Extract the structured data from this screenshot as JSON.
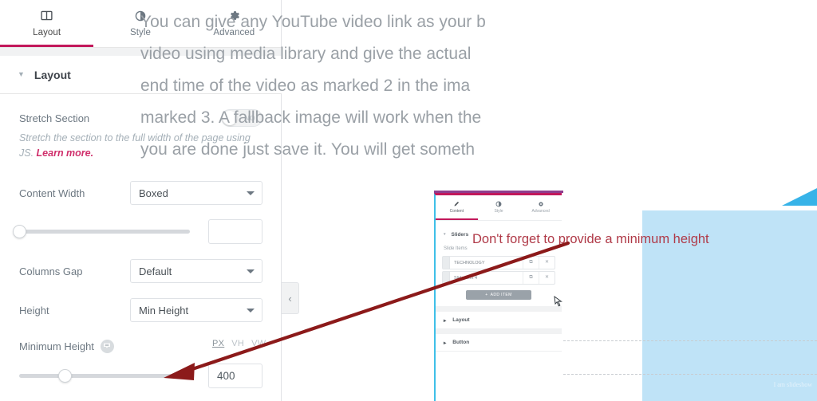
{
  "panel": {
    "tabs": [
      {
        "label": "Layout",
        "icon": "layout-columns-icon",
        "active": true
      },
      {
        "label": "Style",
        "icon": "contrast-circle-icon",
        "active": false
      },
      {
        "label": "Advanced",
        "icon": "gear-icon",
        "active": false
      }
    ],
    "section": {
      "title": "Layout",
      "caret": "▼"
    },
    "stretch": {
      "label": "Stretch Section",
      "toggle_value": "NO",
      "description_plain": "Stretch the section to the full width of the page using JS. ",
      "description_link": "Learn more."
    },
    "content_width": {
      "label": "Content Width",
      "value": "Boxed"
    },
    "content_width_slider": {
      "value": "",
      "thumb_pct": 0
    },
    "columns_gap": {
      "label": "Columns Gap",
      "value": "Default"
    },
    "height": {
      "label": "Height",
      "value": "Min Height"
    },
    "minimum_height": {
      "label": "Minimum Height",
      "units": [
        {
          "label": "PX",
          "active": true
        },
        {
          "label": "VH",
          "active": false
        },
        {
          "label": "VW",
          "active": false
        }
      ],
      "value": "400",
      "thumb_pct": 27
    },
    "collapse_handle": "‹"
  },
  "article": {
    "lines": [
      "You can give any YouTube video link as your b",
      "video using media library and give the actual",
      "end time of the video as marked 2 in the ima",
      "marked 3. A fallback image will work when the",
      "you are done just save it. You will get someth"
    ]
  },
  "annotation": {
    "text": "Don't forget to provide a minimum height",
    "color": "#b03a48"
  },
  "figure": {
    "mini_panel": {
      "tabs": [
        {
          "label": "Content",
          "icon": "pencil-icon",
          "active": true
        },
        {
          "label": "Style",
          "icon": "contrast-circle-icon",
          "active": false
        },
        {
          "label": "Advanced",
          "icon": "gear-icon",
          "active": false
        }
      ],
      "sliders_section": {
        "title": "Sliders",
        "caret": "▾"
      },
      "slide_items_label": "Slide Items",
      "items": [
        {
          "name": "TECHNOLOGY",
          "duplicate_icon": "⧉",
          "delete_icon": "✕"
        },
        {
          "name": "Slide Item 4",
          "duplicate_icon": "⧉",
          "delete_icon": "✕"
        }
      ],
      "add_item_button": "ADD ITEM",
      "add_item_icon": "+",
      "sections": [
        {
          "title": "Layout",
          "caret": "▸"
        },
        {
          "title": "Button",
          "caret": "▸"
        }
      ]
    },
    "canvas": {
      "placeholder_text": "I am slideshow",
      "color": "#bfe3f7",
      "accent_color": "#37b3e8"
    }
  },
  "colors": {
    "accent_pink": "#c2185b",
    "link_pink": "#d0306c",
    "cyan": "#3fc0e8",
    "annotation_red": "#b03a48"
  }
}
